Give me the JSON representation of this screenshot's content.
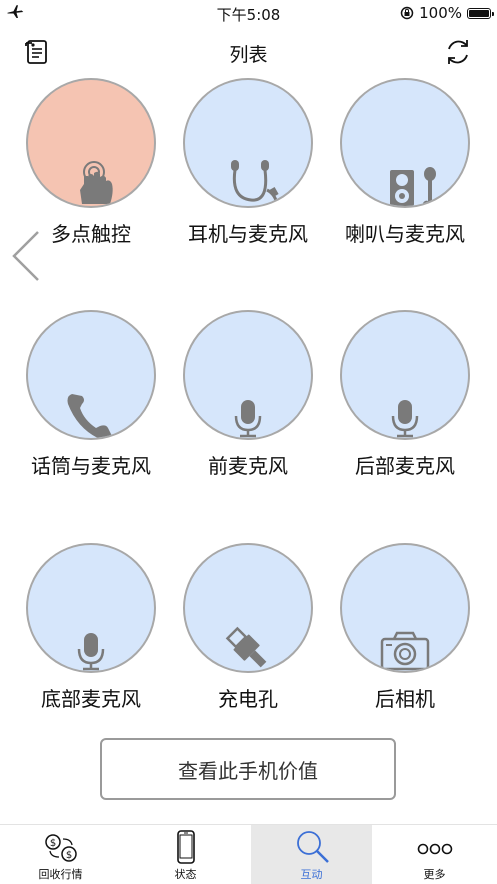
{
  "status_bar": {
    "time": "下午5:08",
    "battery": "100%",
    "icons": [
      "airplane-icon",
      "rotation-lock-icon",
      "battery-icon"
    ]
  },
  "nav": {
    "title": "列表",
    "left_icon": "report-icon",
    "right_icon": "refresh-icon"
  },
  "tiles": [
    {
      "label": "多点触控",
      "icon": "multitouch-hand-icon",
      "active": true
    },
    {
      "label": "耳机与麦克风",
      "icon": "earphones-icon",
      "active": false
    },
    {
      "label": "喇叭与麦克风",
      "icon": "speaker-mic-icon",
      "active": false
    },
    {
      "label": "话筒与麦克风",
      "icon": "phone-handset-icon",
      "active": false
    },
    {
      "label": "前麦克风",
      "icon": "microphone-icon",
      "active": false
    },
    {
      "label": "后部麦克风",
      "icon": "microphone-icon",
      "active": false
    },
    {
      "label": "底部麦克风",
      "icon": "microphone-icon",
      "active": false
    },
    {
      "label": "充电孔",
      "icon": "usb-plug-icon",
      "active": false
    },
    {
      "label": "后相机",
      "icon": "camera-icon",
      "active": false
    }
  ],
  "value_button": {
    "label": "查看此手机价值"
  },
  "tabs": [
    {
      "label": "回收行情",
      "icon": "money-exchange-icon",
      "active": false
    },
    {
      "label": "状态",
      "icon": "phone-icon",
      "active": false
    },
    {
      "label": "互动",
      "icon": "magnifier-icon",
      "active": true
    },
    {
      "label": "更多",
      "icon": "more-dots-icon",
      "active": false
    }
  ],
  "colors": {
    "tile_fill": "#d6e6fb",
    "tile_active_fill": "#f5c4b2",
    "tile_border": "#a8a8a8",
    "icon_gray": "#7a7a7a",
    "tab_active": "#3b6fd6"
  }
}
